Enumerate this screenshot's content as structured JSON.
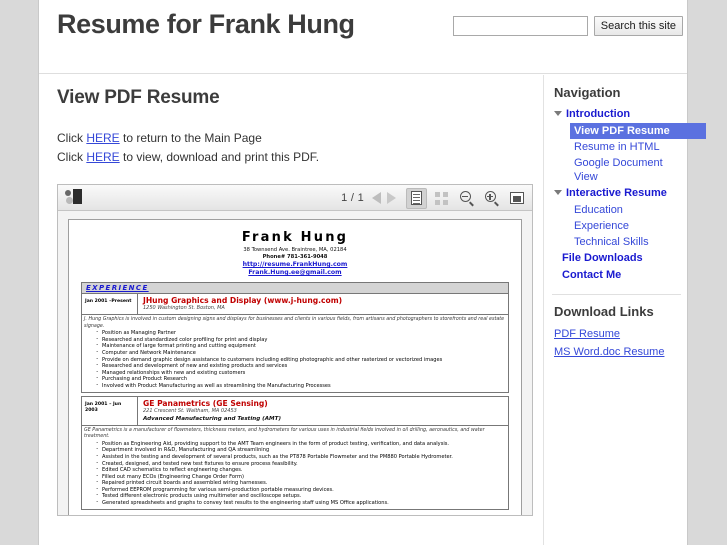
{
  "site": {
    "title": "Resume for Frank Hung",
    "search": {
      "value": "",
      "placeholder": "",
      "button_label": "Search this site"
    }
  },
  "main": {
    "page_title": "View PDF Resume",
    "paragraphs": [
      {
        "before": "Click ",
        "link": "HERE",
        "after": " to return to the Main Page"
      },
      {
        "before": "Click ",
        "link": "HERE",
        "after": " to view, download and print this PDF."
      }
    ]
  },
  "pdf_viewer": {
    "logo_icon": "google-docs-icon",
    "page_indicator": "1 / 1",
    "prev_icon": "triangle-left-icon",
    "next_icon": "triangle-right-icon",
    "single_page_icon": "document-view-icon",
    "grid_page_icon": "grid-view-icon",
    "zoom_out_icon": "zoom-out-icon",
    "zoom_in_icon": "zoom-in-icon",
    "fit_page_icon": "fit-page-icon"
  },
  "resume": {
    "name": "Frank Hung",
    "address": "38 Townsend Ave.  Braintree, MA, 02184",
    "phone": "Phone# 781-361-9048",
    "website": "http://resume.FrankHung.com",
    "email": "Frank.Hung.ee@gmail.com",
    "section_title": "EXPERIENCE",
    "jobs": [
      {
        "dates": "Jan 2001 –Present",
        "company": "JHung Graphics and Display (www.j-hung.com)",
        "location": "1250 Washington St.  Boston, MA",
        "department": "",
        "description": "J. Hung Graphics is involved in custom designing signs and displays for businesses and clients in various fields, from artisans and photographers to storefronts and real estate signage.",
        "bullets": [
          "Position as Managing Partner",
          "Researched and standardized color profiling for print and display",
          "Maintenance of large format printing and cutting equipment",
          "Computer and Network Maintenance",
          "Provide on demand graphic design assistance to customers including editing photographic and other rasterized or vectorized images",
          "Researched and development of new and existing products and services",
          "Managed relationships with new and existing customers",
          "Purchasing and Product Research",
          "Involved with Product Manufacturing as well as streamlining the Manufacturing Processes"
        ]
      },
      {
        "dates": "Jan 2001 – Jun 2003",
        "company": "GE Panametrics (GE Sensing)",
        "location": "221 Crescent St. Waltham, MA 02453",
        "department": "Advanced Manufacturing and Testing (AMT)",
        "description": "GE Panametrics is a manufacturer of flowmeters, thickness meters, and hydrometers for various uses in industrial fields involved in oil drilling, aeronautics, and water treatment.",
        "bullets": [
          "Position as Engineering Aid, providing support to the AMT Team engineers in the form of product testing, verification, and data analysis.",
          "Department involved in R&D, Manufacturing and QA streamlining",
          "Assisted in the testing and development of several products, such as the PT878 Portable Flowmeter and the PM880 Portable Hydrometer.",
          "Created, designed, and tested new test fixtures to ensure process feasibility.",
          "Edited CAD schematics to reflect engineering changes.",
          "Filled out many ECOs (Engineering Change Order Form)",
          "Repaired printed circuit boards and assembled wiring harnesses.",
          "Performed EEPROM programming for various semi-production portable measuring devices.",
          "Tested different electronic products using multimeter and oscilloscope setups.",
          "Generated spreadsheets and graphs to convey test results to the engineering staff using MS Office applications."
        ]
      }
    ]
  },
  "sidebar": {
    "nav_heading": "Navigation",
    "nav": [
      {
        "label": "Introduction",
        "type": "group",
        "expanded": true
      },
      {
        "label": "View PDF Resume",
        "type": "sub",
        "selected": true
      },
      {
        "label": "Resume in HTML",
        "type": "sub",
        "selected": false
      },
      {
        "label": "Google Document View",
        "type": "sub",
        "selected": false
      },
      {
        "label": "Interactive Resume",
        "type": "group",
        "expanded": true
      },
      {
        "label": "Education",
        "type": "sub",
        "selected": false
      },
      {
        "label": "Experience",
        "type": "sub",
        "selected": false
      },
      {
        "label": "Technical Skills",
        "type": "sub",
        "selected": false
      },
      {
        "label": "File Downloads",
        "type": "top",
        "expanded": false
      },
      {
        "label": "Contact Me",
        "type": "top",
        "expanded": false
      }
    ],
    "downloads_heading": "Download Links",
    "downloads": [
      {
        "label": "PDF Resume"
      },
      {
        "label": "MS Word.doc Resume"
      }
    ]
  },
  "colors": {
    "link": "#3548d8",
    "selected_bg": "#5b71e0",
    "nav_bold": "#1a1ad0",
    "company": "#c00000",
    "page_bg": "#d9d9d9"
  }
}
